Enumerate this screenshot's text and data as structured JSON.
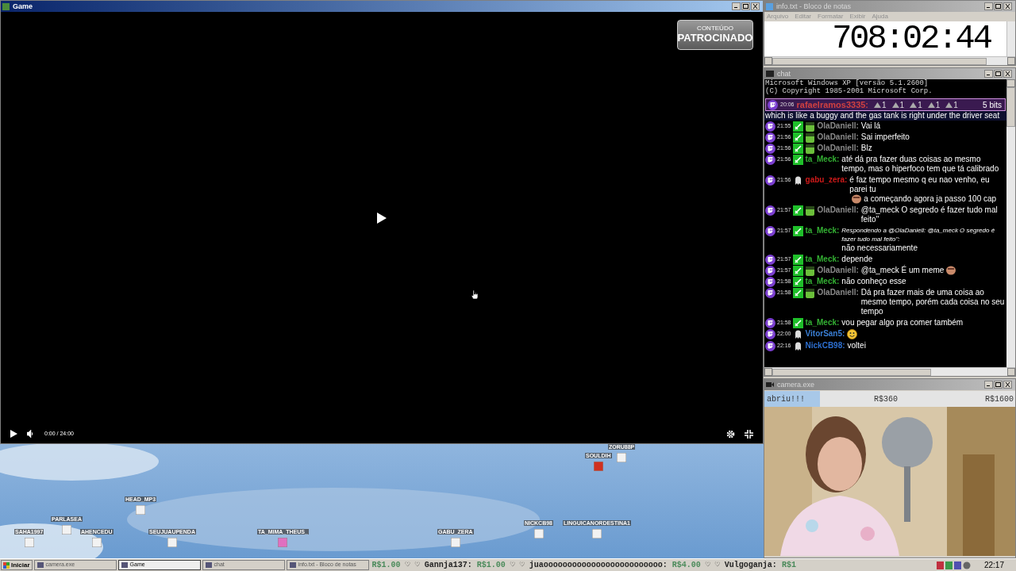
{
  "game_window": {
    "title": "Game",
    "badge": [
      "CONTEÚDO",
      "PATROCINADO"
    ],
    "time": "0:00 / 24:00"
  },
  "game_canvas": {
    "players": [
      "ZORU88P",
      "SOULDIH",
      "HEAD_MP3",
      "PARLASEA",
      "SAHA1997",
      "AHENCEDU",
      "SEUJUAUPENDA",
      "TA_MIMA_THEUS_",
      "GABU_ZERA",
      "NICKCB98",
      "LINGUICANORDESTINA1"
    ]
  },
  "notepad": {
    "title": "info.txt - Bloco de notas",
    "menu": [
      "Arquivo",
      "Editar",
      "Formatar",
      "Exibir",
      "Ajuda"
    ],
    "content": "708:02:44"
  },
  "chat_window": {
    "title": "chat",
    "console": [
      "Microsoft Windows XP [versão 5.1.2600]",
      "(C) Copyright 1985-2001 Microsoft Corp."
    ],
    "cheer": {
      "time": "20:06",
      "user": "rafaelramos3335:",
      "cheers": [
        "1",
        "1",
        "1",
        "1",
        "1"
      ],
      "total": "5 bits"
    },
    "cheer_text": "which is like a buggy and the gas tank is right under the driver seat",
    "messages": [
      {
        "time": "21:55",
        "user": "OlaDaniell:",
        "color": "#8a8a8a",
        "kind": "mod_avatar",
        "text": "Vai lá"
      },
      {
        "time": "21:56",
        "user": "OlaDaniell:",
        "color": "#8a8a8a",
        "kind": "mod_avatar",
        "text": "Sai imperfeito"
      },
      {
        "time": "21:56",
        "user": "OlaDaniell:",
        "color": "#8a8a8a",
        "kind": "mod_avatar",
        "text": "Blz"
      },
      {
        "time": "21:56",
        "user": "ta_Meck:",
        "color": "#33b033",
        "kind": "mod",
        "text": "até dá pra fazer duas coisas ao mesmo tempo, mas o hiperfoco tem que tá calibrado"
      },
      {
        "time": "21:56",
        "user": "gabu_zera:",
        "color": "#d01a1a",
        "kind": "viewer",
        "text": "é faz tempo mesmo q eu nao venho, eu parei tu",
        "emote": true,
        "text_after": "a começando agora ja passo 100 cap"
      },
      {
        "time": "21:57",
        "user": "OlaDaniell:",
        "color": "#8a8a8a",
        "kind": "mod_avatar",
        "text": "@ta_meck O segredo é fazer tudo mal feito\""
      },
      {
        "time": "21:57",
        "user": "ta_Meck:",
        "color": "#33b033",
        "kind": "mod",
        "reply": "Respondendo a @OlaDaniell: @ta_meck O segredo é fazer tudo mal feito\":",
        "text": "não necessariamente"
      },
      {
        "time": "21:57",
        "user": "ta_Meck:",
        "color": "#33b033",
        "kind": "mod",
        "text": "depende"
      },
      {
        "time": "21:57",
        "user": "OlaDaniell:",
        "color": "#8a8a8a",
        "kind": "mod_avatar",
        "text": "@ta_meck É um meme",
        "emote": true
      },
      {
        "time": "21:58",
        "user": "ta_Meck:",
        "color": "#33b033",
        "kind": "mod",
        "text": "não conheço esse"
      },
      {
        "time": "21:58",
        "user": "OlaDaniell:",
        "color": "#8a8a8a",
        "kind": "mod_avatar",
        "text": "Dá pra fazer mais de uma coisa ao mesmo tempo, porém cada coisa no seu tempo"
      },
      {
        "time": "21:58",
        "user": "ta_Meck:",
        "color": "#33b033",
        "kind": "mod",
        "text": "vou pegar algo pra comer também"
      },
      {
        "time": "22:00",
        "user": "VitorSan5:",
        "color": "#3a7fd5",
        "kind": "viewer",
        "smiley": true
      },
      {
        "time": "22:16",
        "user": "NickCB98:",
        "color": "#2d6fd0",
        "kind": "viewer",
        "text": "voltei"
      }
    ]
  },
  "camera_window": {
    "title": "camera.exe",
    "goals": [
      {
        "label": "abriu!!!",
        "selected": true
      },
      {
        "label": "R$360",
        "selected": false
      },
      {
        "label": "R$1600",
        "selected": false
      }
    ]
  },
  "taskbar": {
    "start": "Iniciar",
    "tasks": [
      {
        "label": "camera.exe",
        "selected": false
      },
      {
        "label": "Game",
        "selected": true
      },
      {
        "label": "chat",
        "selected": false
      },
      {
        "label": "info.txt - Bloco de notas",
        "selected": false
      }
    ],
    "ticker": [
      {
        "kind": "amount",
        "text": "R$1.00"
      },
      {
        "kind": "heart",
        "text": "♡"
      },
      {
        "kind": "heart",
        "text": "♡"
      },
      {
        "kind": "user",
        "text": "Gannja137:"
      },
      {
        "kind": "amount",
        "text": "R$1.00"
      },
      {
        "kind": "heart",
        "text": "♡"
      },
      {
        "kind": "heart",
        "text": "♡"
      },
      {
        "kind": "user",
        "text": "juaooooooooooooooooooooooooo:"
      },
      {
        "kind": "amount",
        "text": "R$4.00"
      },
      {
        "kind": "heart",
        "text": "♡"
      },
      {
        "kind": "heart",
        "text": "♡"
      },
      {
        "kind": "user",
        "text": "Vulgoganja:"
      },
      {
        "kind": "amount",
        "text": "R$1"
      }
    ],
    "clock": "22:17"
  }
}
